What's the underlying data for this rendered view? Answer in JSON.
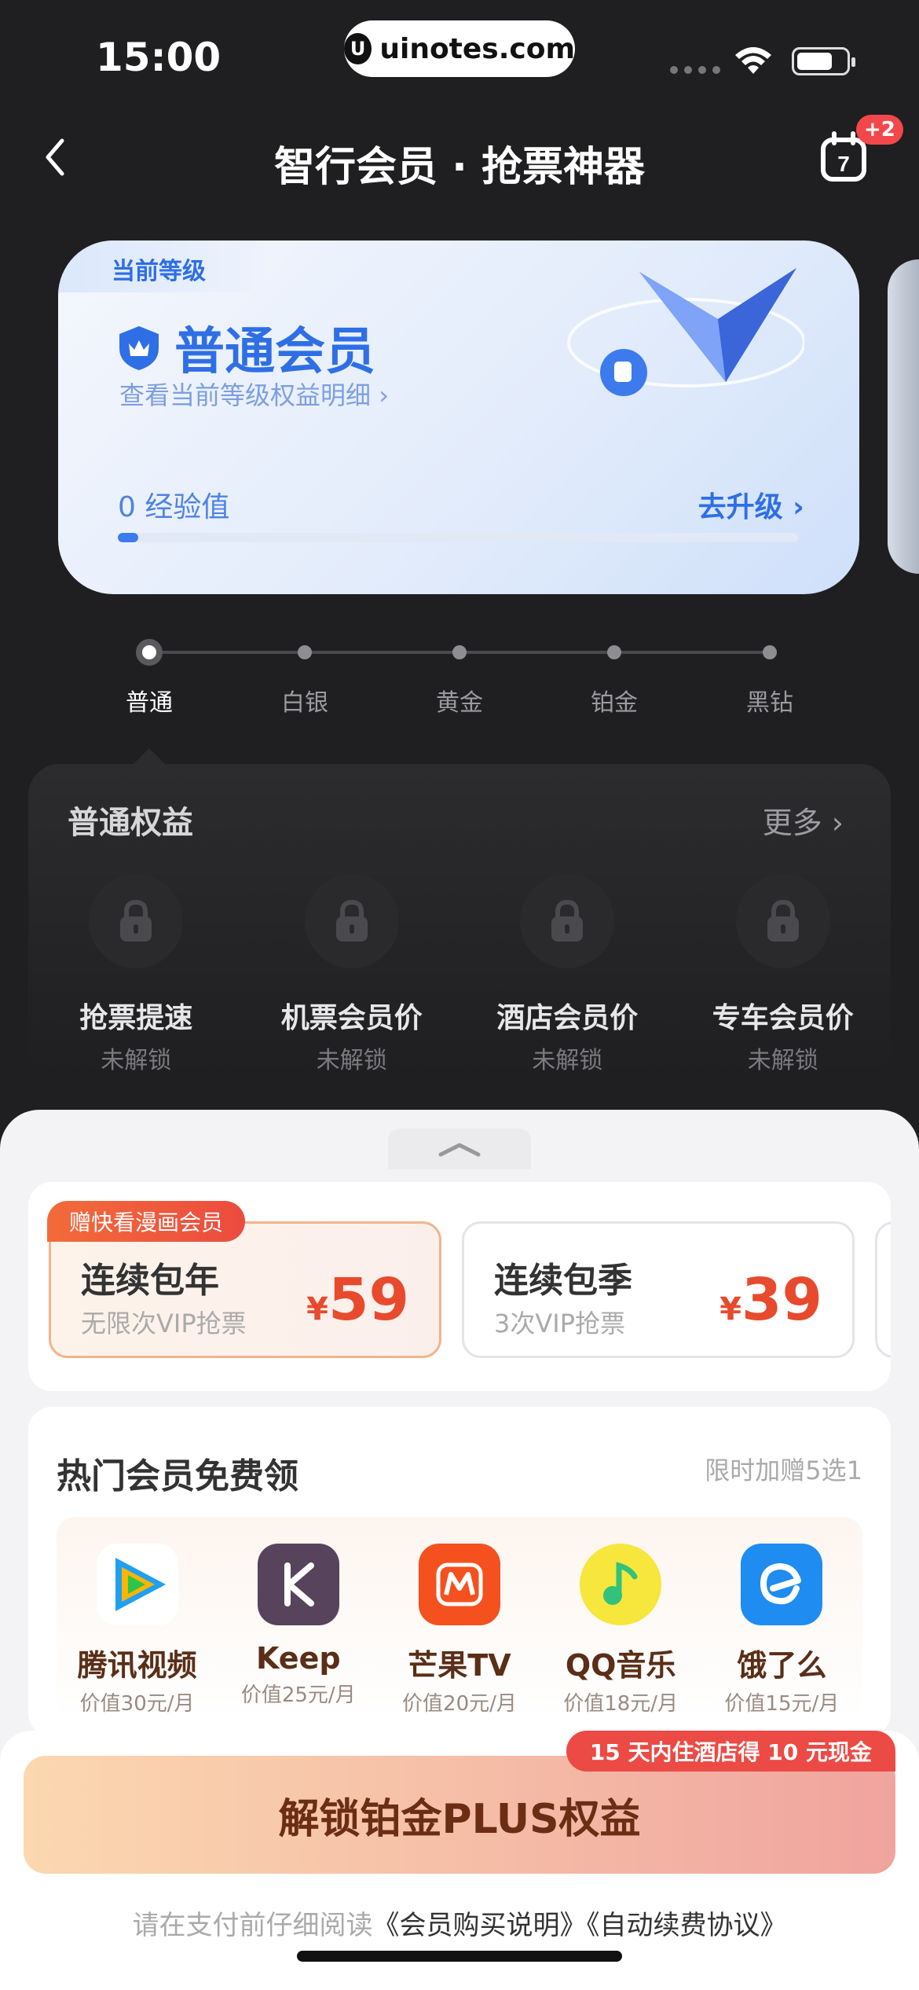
{
  "status": {
    "time": "15:00",
    "url": "uinotes.com"
  },
  "nav": {
    "title": "智行会员 · 抢票神器",
    "calendar_day": "7",
    "calendar_badge": "+2"
  },
  "level_card": {
    "tag": "当前等级",
    "member_level": "普通会员",
    "detail_link": "查看当前等级权益明细",
    "experience": "0 经验值",
    "upgrade": "去升级",
    "progress_fraction": 0.03
  },
  "tiers": [
    "普通",
    "白银",
    "黄金",
    "铂金",
    "黑钻"
  ],
  "benefits": {
    "title": "普通权益",
    "more": "更多",
    "items": [
      {
        "name": "抢票提速",
        "status": "未解锁"
      },
      {
        "name": "机票会员价",
        "status": "未解锁"
      },
      {
        "name": "酒店会员价",
        "status": "未解锁"
      },
      {
        "name": "专车会员价",
        "status": "未解锁"
      }
    ]
  },
  "plans": [
    {
      "tag": "赠快看漫画会员",
      "name": "连续包年",
      "desc": "无限次VIP抢票",
      "currency": "¥",
      "price": "59",
      "selected": true
    },
    {
      "tag": "",
      "name": "连续包季",
      "desc": "3次VIP抢票",
      "currency": "¥",
      "price": "39",
      "selected": false
    }
  ],
  "free": {
    "title": "热门会员免费领",
    "note": "限时加赠5选1",
    "items": [
      {
        "name": "腾讯视频",
        "value": "价值30元/月",
        "icon": "tencent-video-icon"
      },
      {
        "name": "Keep",
        "value": "价值25元/月",
        "icon": "keep-icon"
      },
      {
        "name": "芒果TV",
        "value": "价值20元/月",
        "icon": "mango-tv-icon"
      },
      {
        "name": "QQ音乐",
        "value": "价值18元/月",
        "icon": "qq-music-icon"
      },
      {
        "name": "饿了么",
        "value": "价值15元/月",
        "icon": "eleme-icon"
      }
    ]
  },
  "cta": {
    "badge": "15 天内住酒店得 10 元现金",
    "label": "解锁铂金PLUS权益",
    "agree_prefix": "请在支付前仔细阅读",
    "agree_link1": "《会员购买说明》",
    "agree_link2": "《自动续费协议》"
  },
  "colors": {
    "accent_blue": "#2f6fe6",
    "price_red": "#e84a2d",
    "badge_red": "#ec4a44"
  }
}
